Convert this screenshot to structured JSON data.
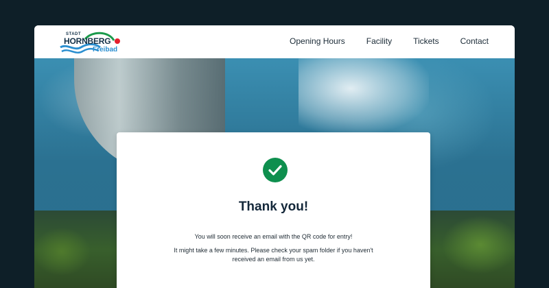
{
  "logo": {
    "stadt": "STADT",
    "name": "HORNBERG",
    "sub": "Freibad",
    "colors": {
      "navy": "#123047",
      "blue": "#2b8fd0",
      "green": "#1a9a4b",
      "red": "#e5202e"
    }
  },
  "nav": {
    "items": [
      {
        "label": "Opening Hours"
      },
      {
        "label": "Facility"
      },
      {
        "label": "Tickets"
      },
      {
        "label": "Contact"
      }
    ]
  },
  "hero": {
    "image": "water-slide-pool-photo"
  },
  "confirmation": {
    "icon": "check-circle-icon",
    "title": "Thank you!",
    "line1": "You will soon receive an email with the QR code for entry!",
    "line2": "It might take a few minutes. Please check your spam folder if you haven't received an email from us yet.",
    "accent": "#0e8f4e"
  }
}
